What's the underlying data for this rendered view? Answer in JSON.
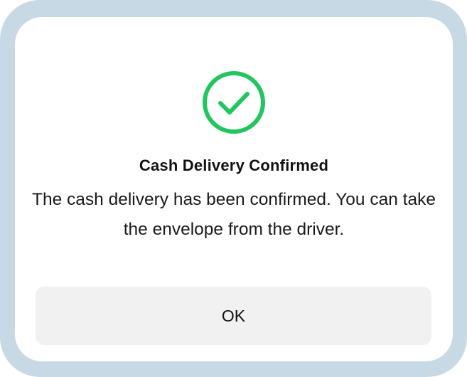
{
  "dialog": {
    "icon": "check-circle-icon",
    "accent_color": "#22c55e",
    "title": "Cash Delivery Confirmed",
    "message": "The cash delivery has been confirmed. You can take the envelope from the driver.",
    "ok_label": "OK"
  }
}
